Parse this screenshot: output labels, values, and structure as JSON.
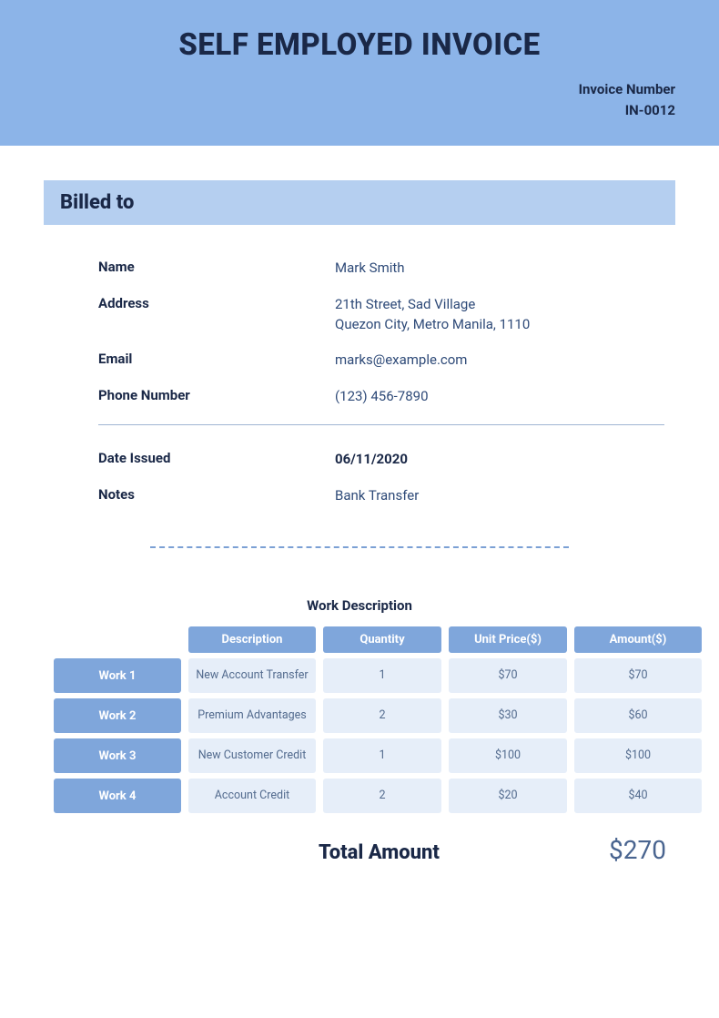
{
  "header": {
    "title": "SELF EMPLOYED INVOICE",
    "invoice_number_label": "Invoice Number",
    "invoice_number": "IN-0012"
  },
  "billed_to": {
    "heading": "Billed to",
    "fields": {
      "name_label": "Name",
      "name": "Mark Smith",
      "address_label": "Address",
      "address_line1": "21th Street, Sad Village",
      "address_line2": "Quezon City, Metro Manila, 1110",
      "email_label": "Email",
      "email": "marks@example.com",
      "phone_label": "Phone Number",
      "phone": "(123) 456-7890",
      "date_issued_label": "Date Issued",
      "date_issued": "06/11/2020",
      "notes_label": "Notes",
      "notes": "Bank Transfer"
    }
  },
  "work": {
    "title": "Work Description",
    "columns": {
      "description": "Description",
      "quantity": "Quantity",
      "unit_price": "Unit Price($)",
      "amount": "Amount($)"
    },
    "rows": [
      {
        "label": "Work 1",
        "description": "New Account Transfer",
        "quantity": "1",
        "unit_price": "$70",
        "amount": "$70"
      },
      {
        "label": "Work 2",
        "description": "Premium Advantages",
        "quantity": "2",
        "unit_price": "$30",
        "amount": "$60"
      },
      {
        "label": "Work 3",
        "description": "New Customer Credit",
        "quantity": "1",
        "unit_price": "$100",
        "amount": "$100"
      },
      {
        "label": "Work 4",
        "description": "Account Credit",
        "quantity": "2",
        "unit_price": "$20",
        "amount": "$40"
      }
    ]
  },
  "total": {
    "label": "Total Amount",
    "value": "$270"
  }
}
